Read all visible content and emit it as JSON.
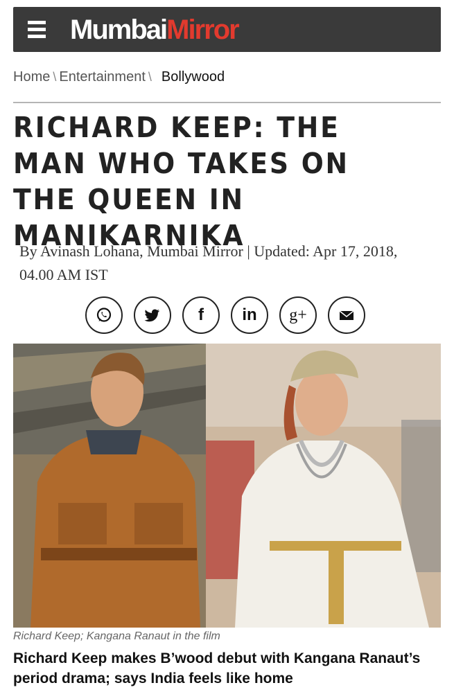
{
  "header": {
    "logo_part1": "Mumbai",
    "logo_part2": "Mirror",
    "bg_color": "#3a3a3a",
    "accent_color": "#e23a2e"
  },
  "breadcrumb": {
    "items": [
      "Home",
      "Entertainment",
      "Bollywood"
    ],
    "separator": "\\"
  },
  "article": {
    "headline": "RICHARD KEEP: THE MAN WHO TAKES ON THE QUEEN IN MANIKARNIKA",
    "byline": "By Avinash Lohana, Mumbai Mirror | Updated: Apr 17, 2018, 04.00 AM IST",
    "caption": "Richard Keep; Kangana Ranaut in the film",
    "subheadline": "Richard Keep makes B’wood debut with Kangana Ranaut’s period drama; says India feels like home"
  },
  "share": {
    "icons": [
      "whatsapp-icon",
      "twitter-icon",
      "facebook-icon",
      "linkedin-icon",
      "googleplus-icon",
      "email-icon"
    ],
    "facebook_glyph": "f",
    "linkedin_glyph": "in",
    "googleplus_glyph": "g+"
  }
}
